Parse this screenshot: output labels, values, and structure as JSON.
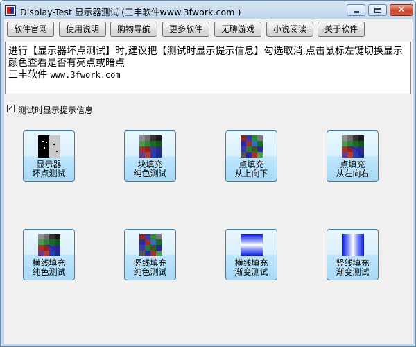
{
  "window": {
    "title": "Display-Test 显示器测试 (三丰软件www.3fwork.com )",
    "close_glyph": "✕"
  },
  "toolbar": {
    "buttons": [
      {
        "label": "软件官网"
      },
      {
        "label": "使用说明"
      },
      {
        "label": "购物导航"
      },
      {
        "label": "更多软件"
      },
      {
        "label": "无聊游戏"
      },
      {
        "label": "小说阅读"
      },
      {
        "label": "关于软件"
      }
    ]
  },
  "info": {
    "line1": "进行【显示器坏点测试】时,建议把【测试时显示提示信息】勾选取消,点击鼠标左键切换显示",
    "line2": "颜色查看是否有亮点或暗点",
    "line3_name": "三丰软件",
    "line3_site": "www.3fwork.com"
  },
  "option": {
    "checked": true,
    "check_glyph": "✓",
    "label": "测试时显示提示信息"
  },
  "tiles": [
    {
      "line1": "显示器",
      "line2": "坏点测试",
      "icon": "dead-pixel-icon"
    },
    {
      "line1": "块填充",
      "line2": "纯色测试",
      "icon": "block-fill-icon"
    },
    {
      "line1": "点填充",
      "line2": "从上向下",
      "icon": "dot-fill-down-icon"
    },
    {
      "line1": "点填充",
      "line2": "从左向右",
      "icon": "dot-fill-right-icon"
    },
    {
      "line1": "横线填充",
      "line2": "纯色测试",
      "icon": "hline-solid-icon"
    },
    {
      "line1": "竖线填充",
      "line2": "纯色测试",
      "icon": "vline-solid-icon"
    },
    {
      "line1": "横线填充",
      "line2": "渐变测试",
      "icon": "hline-gradient-icon"
    },
    {
      "line1": "竖线填充",
      "line2": "渐变测试",
      "icon": "vline-gradient-icon"
    }
  ],
  "colors": {
    "titlebar": "#c6d9ec",
    "client_bg": "#f0f0f0",
    "tile_border": "#3c7fb1",
    "close_red": "#c9482e"
  }
}
